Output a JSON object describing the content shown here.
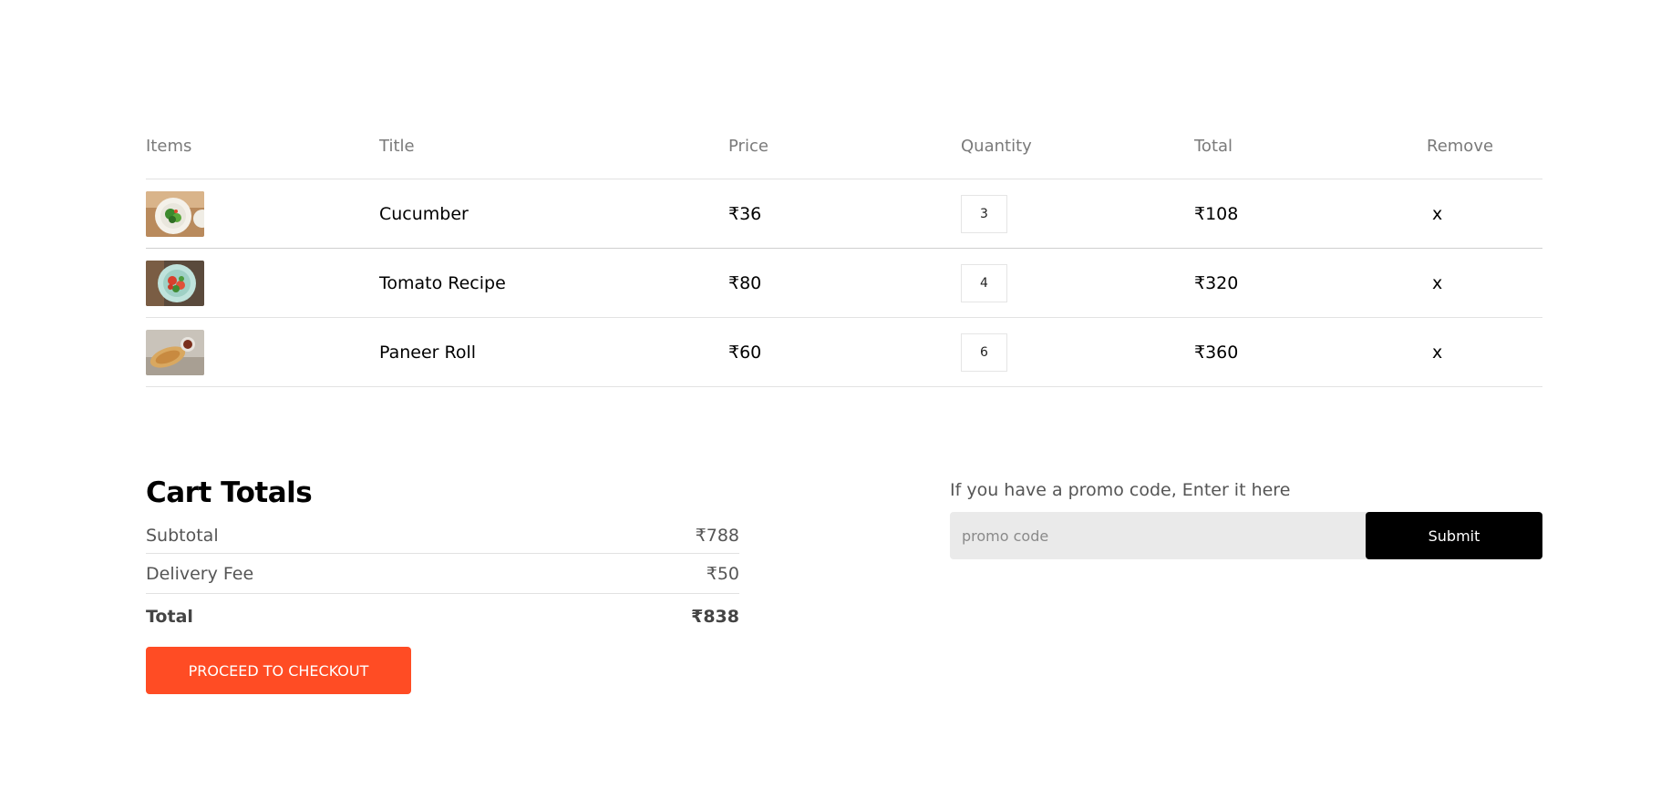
{
  "table": {
    "headers": [
      "Items",
      "Title",
      "Price",
      "Quantity",
      "Total",
      "Remove"
    ],
    "rows": [
      {
        "image": "cucumber-salad-image",
        "title": "Cucumber",
        "price": "₹36",
        "quantity": "3",
        "total": "₹108",
        "remove": "x"
      },
      {
        "image": "tomato-recipe-image",
        "title": "Tomato Recipe",
        "price": "₹80",
        "quantity": "4",
        "total": "₹320",
        "remove": "x"
      },
      {
        "image": "paneer-roll-image",
        "title": "Paneer Roll",
        "price": "₹60",
        "quantity": "6",
        "total": "₹360",
        "remove": "x"
      }
    ]
  },
  "cart_totals": {
    "title": "Cart Totals",
    "subtotal_label": "Subtotal",
    "subtotal_value": "₹788",
    "delivery_label": "Delivery Fee",
    "delivery_value": "₹50",
    "total_label": "Total",
    "total_value": "₹838",
    "checkout_label": "PROCEED TO CHECKOUT"
  },
  "promo": {
    "label": "If you have a promo code, Enter it here",
    "placeholder": "promo code",
    "submit_label": "Submit"
  },
  "colors": {
    "accent": "#ff4c24",
    "submit_bg": "#000000",
    "input_bg": "#eaeaea"
  }
}
